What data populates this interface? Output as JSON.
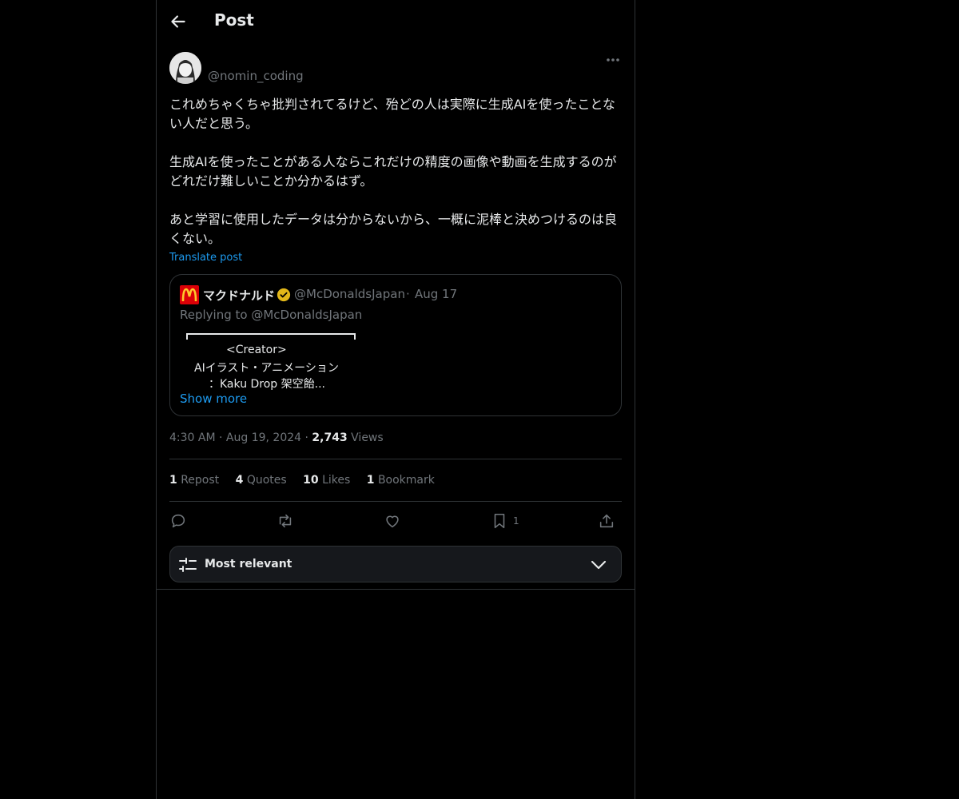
{
  "header": {
    "title": "Post"
  },
  "author": {
    "handle": "@nomin_coding"
  },
  "post": {
    "text": "これめちゃくちゃ批判されてるけど、殆どの人は実際に生成AIを使ったことない人だと思う。\n\n生成AIを使ったことがある人ならこれだけの精度の画像や動画を生成するのがどれだけ難しいことか分かるはず。\n\nあと学習に使用したデータは分からないから、一概に泥棒と決めつけるのは良くない。",
    "translate_label": "Translate post"
  },
  "quote": {
    "name": "マクドナルド",
    "handle": "@McDonaldsJapan",
    "dot": "·",
    "date": "Aug 17",
    "replying": "Replying to @McDonaldsJapan",
    "line1": "<Creator>",
    "line2": "AIイラスト・アニメーション",
    "line3": "：Kaku Drop 架空飴...",
    "show_more": "Show more",
    "logo_color": "#db0007",
    "logo_accent": "#ffc72c"
  },
  "meta": {
    "time": "4:30 AM",
    "sep1": "·",
    "date": "Aug 19, 2024",
    "sep2": "·",
    "views_count": "2,743",
    "views_label": "Views"
  },
  "stats": [
    {
      "count": "1",
      "label": "Repost"
    },
    {
      "count": "4",
      "label": "Quotes"
    },
    {
      "count": "10",
      "label": "Likes"
    },
    {
      "count": "1",
      "label": "Bookmark"
    }
  ],
  "actions": {
    "reply_icon": "reply-icon",
    "repost_icon": "repost-icon",
    "like_icon": "heart-icon",
    "bookmark_icon": "bookmark-icon",
    "bookmark_count": "1",
    "share_icon": "share-icon"
  },
  "sort": {
    "label": "Most relevant"
  },
  "colors": {
    "accent": "#1d9bf0",
    "muted": "#71767b",
    "border": "#2f3336",
    "verified": "#e2b719"
  }
}
